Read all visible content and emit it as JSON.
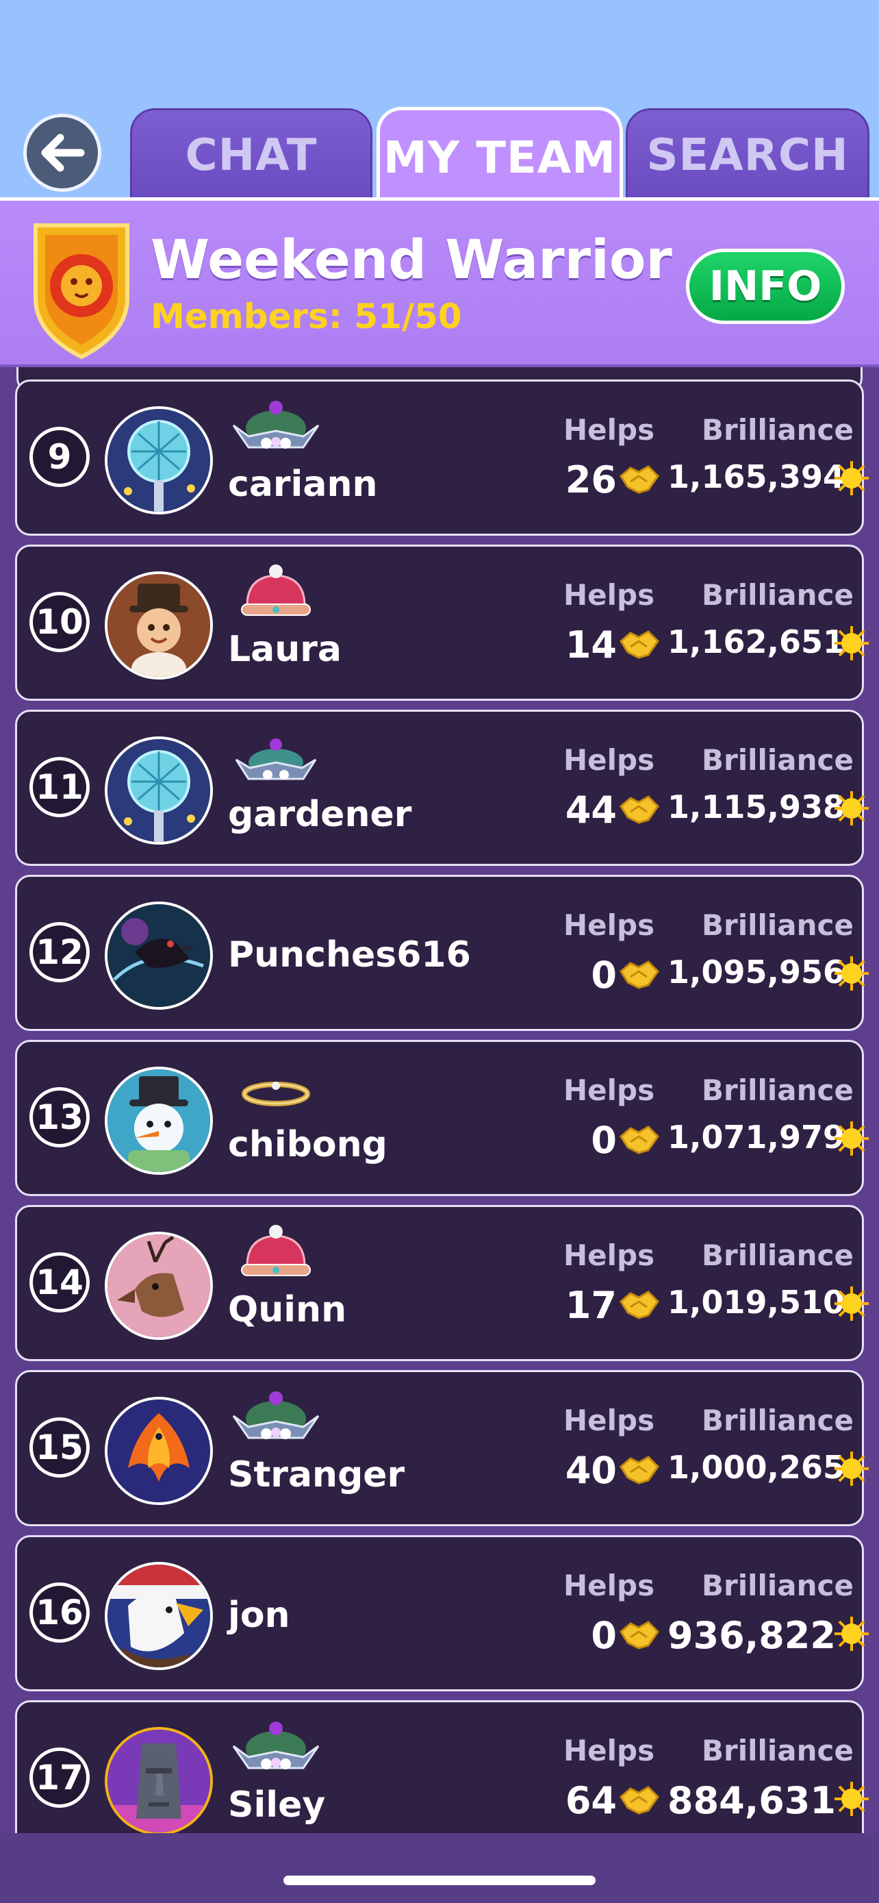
{
  "tabs": [
    {
      "label": "CHAT",
      "active": false
    },
    {
      "label": "MY TEAM",
      "active": true
    },
    {
      "label": "SEARCH",
      "active": false
    }
  ],
  "team": {
    "name": "Weekend Warrior",
    "members": "Members: 51/50",
    "info_label": "INFO",
    "emblem_icon": "lion-shield-icon"
  },
  "columns": {
    "helps": "Helps",
    "brilliance": "Brilliance"
  },
  "members": [
    {
      "rank": "9",
      "name": "cariann",
      "helps": "26",
      "brilliance": "1,165,394",
      "avatar": "globe-avatar",
      "crown": "green-crown"
    },
    {
      "rank": "10",
      "name": "Laura",
      "helps": "14",
      "brilliance": "1,162,651",
      "avatar": "baby-avatar",
      "crown": "pink-crown"
    },
    {
      "rank": "11",
      "name": "gardener",
      "helps": "44",
      "brilliance": "1,115,938",
      "avatar": "globe-avatar",
      "crown": "teal-crown"
    },
    {
      "rank": "12",
      "name": "Punches616",
      "helps": "0",
      "brilliance": "1,095,956",
      "avatar": "raven-avatar",
      "crown": "none"
    },
    {
      "rank": "13",
      "name": "chibong",
      "helps": "0",
      "brilliance": "1,071,979",
      "avatar": "snowman-avatar",
      "crown": "gold-circlet"
    },
    {
      "rank": "14",
      "name": "Quinn",
      "helps": "17",
      "brilliance": "1,019,510",
      "avatar": "deer-avatar",
      "crown": "pink-crown"
    },
    {
      "rank": "15",
      "name": "Stranger",
      "helps": "40",
      "brilliance": "1,000,265",
      "avatar": "phoenix-avatar",
      "crown": "green-crown"
    },
    {
      "rank": "16",
      "name": "jon",
      "helps": "0",
      "brilliance": "936,822",
      "avatar": "eagle-avatar",
      "crown": "none"
    },
    {
      "rank": "17",
      "name": "Siley",
      "helps": "64",
      "brilliance": "884,631",
      "avatar": "moai-avatar",
      "crown": "green-crown"
    }
  ],
  "colors": {
    "sky": "#98c2fd",
    "header": "#b98af9",
    "tab_inactive": "#7d5fd2",
    "card": "#2e2143",
    "info_green": "#10c258",
    "members_gold": "#ffd21f"
  }
}
